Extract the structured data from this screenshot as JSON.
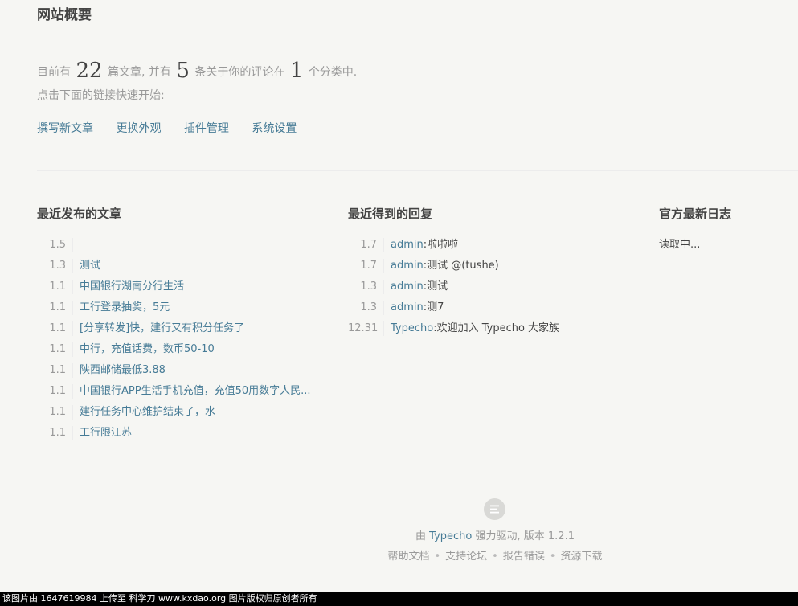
{
  "page": {
    "title": "网站概要"
  },
  "summary": {
    "prefix": "目前有",
    "posts_count": "22",
    "posts_suffix": "篇文章, 并有",
    "comments_count": "5",
    "comments_suffix": "条关于你的评论在",
    "categories_count": "1",
    "categories_suffix": "个分类中.",
    "hint": "点击下面的链接快速开始:"
  },
  "quick_links": {
    "write": "撰写新文章",
    "theme": "更换外观",
    "plugins": "插件管理",
    "settings": "系统设置"
  },
  "recent_posts": {
    "title": "最近发布的文章",
    "items": [
      {
        "date": "1.5",
        "title": ""
      },
      {
        "date": "1.3",
        "title": "测试"
      },
      {
        "date": "1.1",
        "title": "中国银行湖南分行生活"
      },
      {
        "date": "1.1",
        "title": "工行登录抽奖，5元"
      },
      {
        "date": "1.1",
        "title": "[分享转发]快，建行又有积分任务了"
      },
      {
        "date": "1.1",
        "title": "中行，充值话费，数币50-10"
      },
      {
        "date": "1.1",
        "title": "陕西邮储最低3.88"
      },
      {
        "date": "1.1",
        "title": "中国银行APP生活手机充值，充值50用数字人民..."
      },
      {
        "date": "1.1",
        "title": "建行任务中心维护结束了，水"
      },
      {
        "date": "1.1",
        "title": "工行限江苏"
      }
    ]
  },
  "recent_replies": {
    "title": "最近得到的回复",
    "items": [
      {
        "date": "1.7",
        "author": "admin",
        "text": "啦啦啦"
      },
      {
        "date": "1.7",
        "author": "admin",
        "text": "测试 @(tushe)"
      },
      {
        "date": "1.3",
        "author": "admin",
        "text": "测试"
      },
      {
        "date": "1.3",
        "author": "admin",
        "text": "测7"
      },
      {
        "date": "12.31",
        "author": "Typecho",
        "text": "欢迎加入 Typecho 大家族"
      }
    ]
  },
  "official_logs": {
    "title": "官方最新日志",
    "loading": "读取中..."
  },
  "footer": {
    "by": "由",
    "typecho": "Typecho",
    "powered": "强力驱动, 版本 1.2.1",
    "links": {
      "docs": "帮助文档",
      "forum": "支持论坛",
      "report": "报告错误",
      "downloads": "资源下载"
    },
    "separator": "•"
  },
  "watermark": {
    "text": "该图片由 1647619984 上传至 科学刀 www.kxdao.org 图片版权归原创者所有"
  },
  "colors": {
    "background": "#f6f6f3",
    "link": "#467b96",
    "text": "#444444",
    "muted": "#999999"
  }
}
